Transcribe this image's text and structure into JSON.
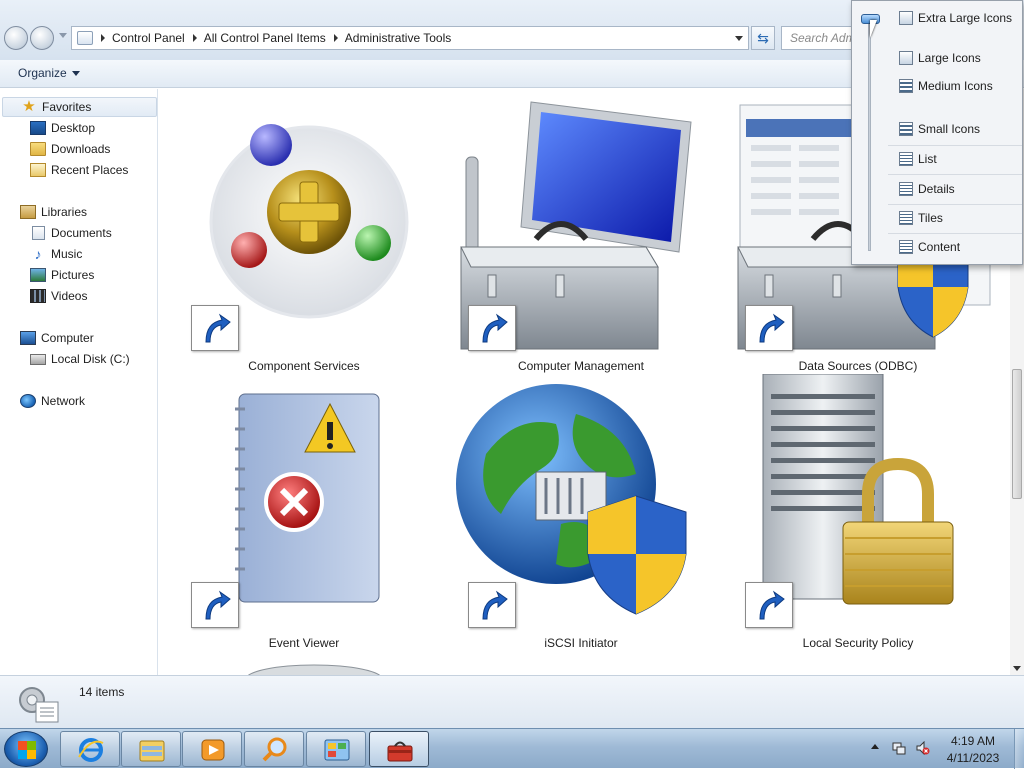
{
  "address_bar": {
    "breadcrumbs": [
      "Control Panel",
      "All Control Panel Items",
      "Administrative Tools"
    ],
    "search_placeholder": "Search Adm"
  },
  "toolbar": {
    "organize_label": "Organize"
  },
  "navigation": {
    "favorites": {
      "label": "Favorites",
      "items": [
        "Desktop",
        "Downloads",
        "Recent Places"
      ]
    },
    "libraries": {
      "label": "Libraries",
      "items": [
        "Documents",
        "Music",
        "Pictures",
        "Videos"
      ]
    },
    "computer": {
      "label": "Computer",
      "items": [
        "Local Disk (C:)"
      ]
    },
    "network": {
      "label": "Network"
    }
  },
  "items": [
    {
      "label": "Component Services",
      "icon": "component-services-icon"
    },
    {
      "label": "Computer Management",
      "icon": "computer-management-icon"
    },
    {
      "label": "Data Sources (ODBC)",
      "icon": "data-sources-icon"
    },
    {
      "label": "Event Viewer",
      "icon": "event-viewer-icon"
    },
    {
      "label": "iSCSI Initiator",
      "icon": "iscsi-initiator-icon"
    },
    {
      "label": "Local Security Policy",
      "icon": "local-security-policy-icon"
    }
  ],
  "view_menu": {
    "options": [
      "Extra Large Icons",
      "Large Icons",
      "Medium Icons",
      "Small Icons",
      "List",
      "Details",
      "Tiles",
      "Content"
    ]
  },
  "details": {
    "item_count": "14 items"
  },
  "taskbar": {
    "time": "4:19 AM",
    "date": "4/11/2023"
  }
}
